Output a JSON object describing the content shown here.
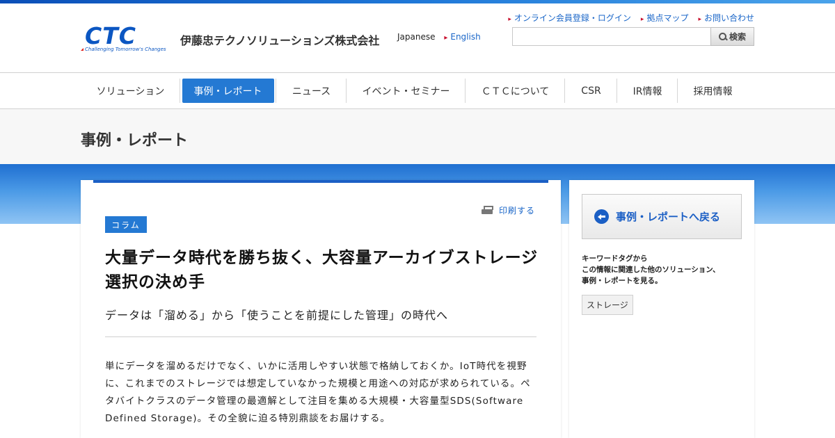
{
  "header": {
    "logo_text": "CTC",
    "logo_tagline": "Challenging Tomorrow's Changes",
    "company_name": "伊藤忠テクノソリューションズ株式会社",
    "languages": {
      "current": "Japanese",
      "other": "English"
    },
    "top_links": [
      "オンライン会員登録・ログイン",
      "拠点マップ",
      "お問い合わせ"
    ],
    "search": {
      "placeholder": "",
      "button_label": "検索"
    }
  },
  "nav": {
    "items": [
      "ソリューション",
      "事例・レポート",
      "ニュース",
      "イベント・セミナー",
      "ＣＴＣについて",
      "CSR",
      "IR情報",
      "採用情報"
    ],
    "active": "事例・レポート"
  },
  "page": {
    "title": "事例・レポート"
  },
  "article": {
    "print_label": "印刷する",
    "category": "コラム",
    "headline": "大量データ時代を勝ち抜く、大容量アーカイブストレージ選択の決め手",
    "subtitle": "データは「溜める」から「使うことを前提にした管理」の時代へ",
    "lead": "単にデータを溜めるだけでなく、いかに活用しやすい状態で格納しておくか。IoT時代を視野に、これまでのストレージでは想定していなかった規模と用途への対応が求められている。ペタバイトクラスのデータ管理の最適解として注目を集める大規模・大容量型SDS(Software Defined Storage)。その全貌に迫る特別鼎談をお届けする。"
  },
  "sidebar": {
    "back_label": "事例・レポートへ戻る",
    "tag_note_lines": [
      "キーワードタグから",
      "この情報に関連した他のソリューション、",
      "事例・レポートを見る。"
    ],
    "tags": [
      "ストレージ"
    ]
  }
}
